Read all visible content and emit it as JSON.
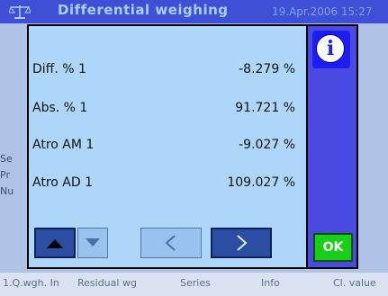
{
  "window": {
    "title": "Differential weighing",
    "datetime": "19.Apr.2006 15:27",
    "icon": "balance-icon"
  },
  "background_letters": [
    "Se",
    "Pr",
    "Nu"
  ],
  "bottom_bar": {
    "items": [
      "1.Q.wgh. In",
      "Residual wg",
      "Series",
      "Info",
      "Cl. value"
    ]
  },
  "dialog": {
    "rows": [
      {
        "label": "Diff. % 1",
        "value": "-8.279 %"
      },
      {
        "label": "Abs. % 1",
        "value": "91.721 %"
      },
      {
        "label": "Atro AM 1",
        "value": "-9.027 %"
      },
      {
        "label": "Atro AD 1",
        "value": "109.027 %"
      }
    ],
    "info_icon": "info-icon",
    "ok_label": "OK",
    "nav_icons": [
      "arrow-up-icon",
      "arrow-down-icon",
      "arrow-left-icon",
      "arrow-right-icon"
    ]
  }
}
